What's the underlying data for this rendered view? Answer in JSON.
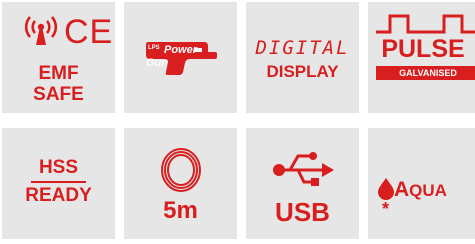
{
  "colors": {
    "accent": "#d81e1e",
    "tile_bg": "#e6e6e6"
  },
  "tiles": {
    "emf": {
      "icon": "radio-waves-icon",
      "ce_mark": "CE",
      "line1": "EMF",
      "line2": "SAFE"
    },
    "power_gun": {
      "icon": "power-gun-icon",
      "tiny": "LPS",
      "line1": "Power",
      "line2": "Gun"
    },
    "digital": {
      "line1": "DIGITAL",
      "line2": "DISPLAY"
    },
    "pulse": {
      "icon": "pulse-waveform-icon",
      "line1": "PULSE",
      "line2": "GALVANISED"
    },
    "hss": {
      "line1": "HSS",
      "line2": "READY"
    },
    "cable": {
      "icon": "cable-coil-icon",
      "label": "5m"
    },
    "usb": {
      "icon": "usb-icon",
      "label": "USB"
    },
    "aqua": {
      "icon": "water-drop-icon",
      "first": "A",
      "rest": "QUA",
      "mark": "*"
    }
  }
}
